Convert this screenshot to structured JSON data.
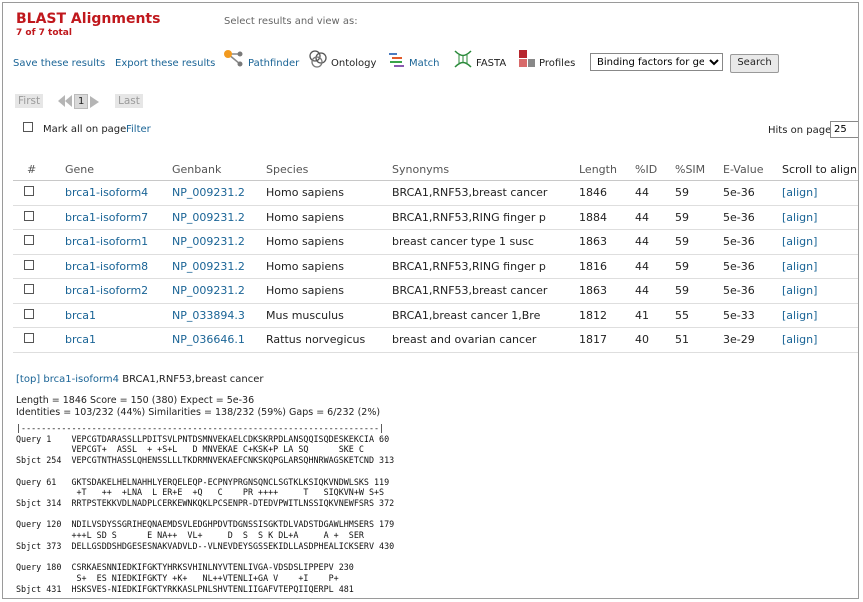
{
  "header": {
    "title": "BLAST Alignments",
    "subtitle": "7 of 7 total",
    "select_hint": "Select results and view as:"
  },
  "toolbar": {
    "save_label": "Save these results",
    "export_label": "Export these results",
    "tools": [
      {
        "label": "Pathfinder",
        "icon": "pathfinder-icon"
      },
      {
        "label": "Ontology",
        "icon": "ontology-icon"
      },
      {
        "label": "Match",
        "icon": "match-icon"
      },
      {
        "label": "FASTA",
        "icon": "fasta-icon"
      },
      {
        "label": "Profiles",
        "icon": "profiles-icon"
      }
    ],
    "dropdown_value": "Binding factors for gene",
    "search_label": "Search"
  },
  "pager": {
    "first": "First",
    "current": "1",
    "last": "Last"
  },
  "selection": {
    "mark_all": "Mark all on page",
    "filter": "Filter",
    "hits_label": "Hits on page",
    "hits_value": "25"
  },
  "table": {
    "headers": [
      "#",
      "Gene",
      "Genbank",
      "Species",
      "Synonyms",
      "Length",
      "%ID",
      "%SIM",
      "E-Value",
      "Scroll to align"
    ],
    "rows": [
      {
        "gene": "brca1-isoform4",
        "genbank": "NP_009231.2",
        "species": "Homo sapiens",
        "synonyms": "BRCA1,RNF53,breast cancer",
        "length": "1846",
        "id": "44",
        "sim": "59",
        "evalue": "5e-36",
        "align": "[align]"
      },
      {
        "gene": "brca1-isoform7",
        "genbank": "NP_009231.2",
        "species": "Homo sapiens",
        "synonyms": "BRCA1,RNF53,RING finger p",
        "length": "1884",
        "id": "44",
        "sim": "59",
        "evalue": "5e-36",
        "align": "[align]"
      },
      {
        "gene": "brca1-isoform1",
        "genbank": "NP_009231.2",
        "species": "Homo sapiens",
        "synonyms": "breast cancer type 1 susc",
        "length": "1863",
        "id": "44",
        "sim": "59",
        "evalue": "5e-36",
        "align": "[align]"
      },
      {
        "gene": "brca1-isoform8",
        "genbank": "NP_009231.2",
        "species": "Homo sapiens",
        "synonyms": "BRCA1,RNF53,RING finger p",
        "length": "1816",
        "id": "44",
        "sim": "59",
        "evalue": "5e-36",
        "align": "[align]"
      },
      {
        "gene": "brca1-isoform2",
        "genbank": "NP_009231.2",
        "species": "Homo sapiens",
        "synonyms": "BRCA1,RNF53,breast cancer",
        "length": "1863",
        "id": "44",
        "sim": "59",
        "evalue": "5e-36",
        "align": "[align]"
      },
      {
        "gene": "brca1",
        "genbank": "NP_033894.3",
        "species": "Mus musculus",
        "synonyms": "BRCA1,breast cancer 1,Bre",
        "length": "1812",
        "id": "41",
        "sim": "55",
        "evalue": "5e-33",
        "align": "[align]"
      },
      {
        "gene": "brca1",
        "genbank": "NP_036646.1",
        "species": "Rattus norvegicus",
        "synonyms": "breast and ovarian cancer",
        "length": "1817",
        "id": "40",
        "sim": "51",
        "evalue": "3e-29",
        "align": "[align]"
      }
    ]
  },
  "alignment": {
    "top_link": "[top]",
    "gene_link": "brca1-isoform4",
    "gene_desc": "BRCA1,RNF53,breast cancer",
    "stats_line1": "Length = 1846  Score = 150 (380)  Expect = 5e-36",
    "stats_line2": "Identities = 103/232 (44%) Similarities = 138/232 (59%) Gaps = 6/232 (2%)",
    "text": "|-----------------------------------------------------------------------|\nQuery 1    VEPCGTDARASSLLPDITSVLPNTDSMNVEKAELCDKSKRPDLANSQQISQDESKEKCIA 60\n           VEPCGT+  ASSL  + +S+L   D MNVEKAE C+KSK+P LA SQ      SKE C\nSbjct 254  VEPCGTNTHASSLQHENSSLLLTKDRMNVEKAEFCNKSKQPGLARSQHNRWAGSKETCND 313\n\nQuery 61   GKTSDAKELHELNAHHLYERQELEQP-ECPNYPRGNSQNCLSGTKLKSIQKVNDWLSKS 119\n            +T   ++  +LNA  L ER+E  +Q   C    PR ++++     T   SIQKVN+W S+S\nSbjct 314  RRTPSTEKKVDLNADPLCERKEWNKQKLPCSENPR-DTEDVPWITLNSSIQKVNEWFSRS 372\n\nQuery 120  NDILVSDYSSGRIHEQNAEMDSVLEDGHPDVTDGNSSISGKTDLVADSTDGAWLHMSERS 179\n           +++L SD S      E NA++  VL+     D  S  S K DL+A     A +  SER\nSbjct 373  DELLGSDDSHDGESESNAKVADVLD--VLNEVDEYSGSSEKIDLLASDPHEALICKSERV 430\n\nQuery 180  CSRKAESNNIEDKIFGKTYHRKSVHINLNYVTENLIVGA-VDSDSLIPPEPV 230\n            S+  ES NIEDKIFGKTY +K+   NL++VTENLI+GA V    +I    P+\nSbjct 431  HSKSVES-NIEDKIFGKTYRKKASLPNLSHVTENLIIGAFVTEPQIIQERPL 481"
  }
}
